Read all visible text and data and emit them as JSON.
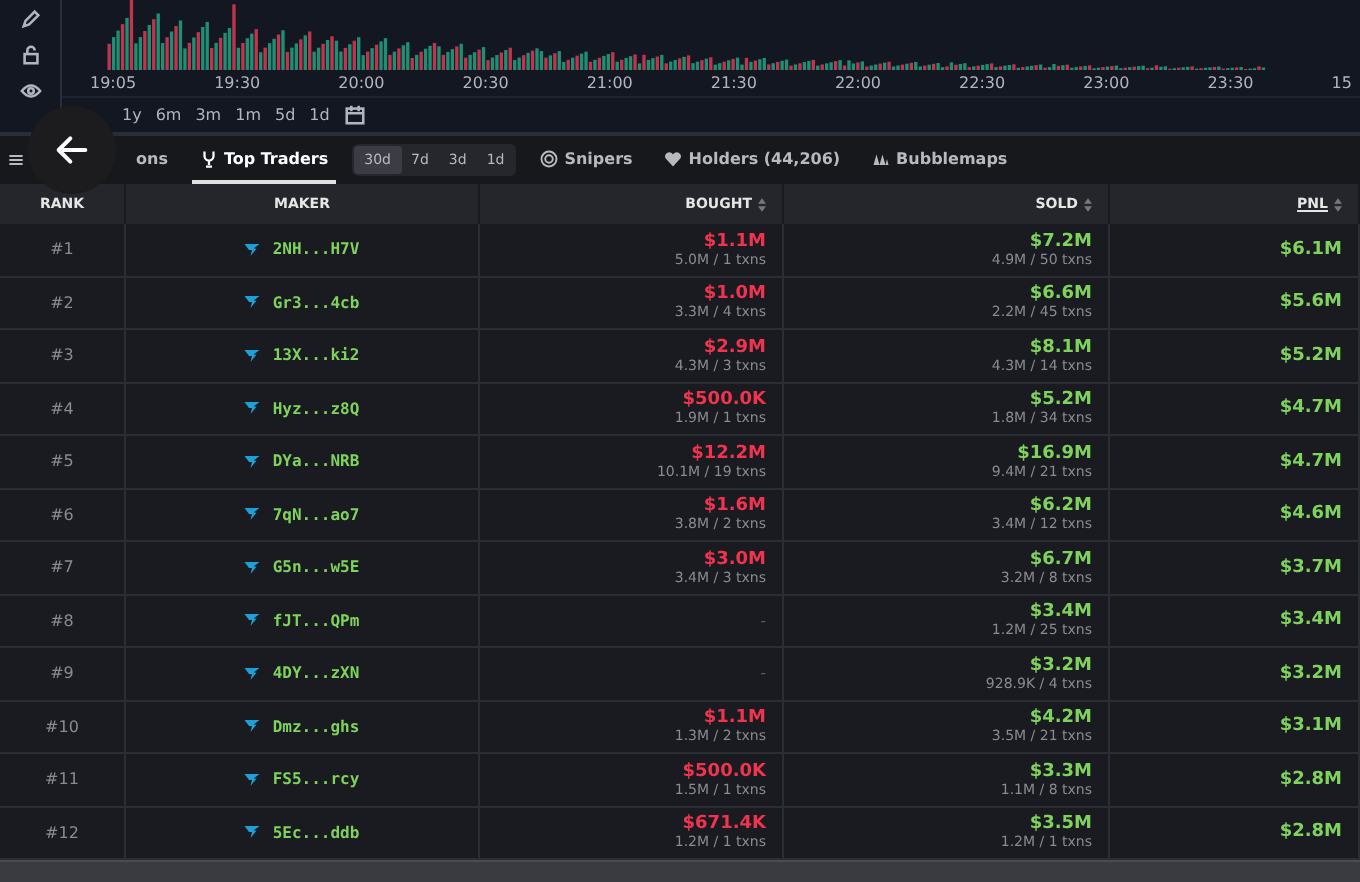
{
  "chart": {
    "time_labels": [
      "19:05",
      "19:30",
      "20:00",
      "20:30",
      "21:00",
      "21:30",
      "22:00",
      "22:30",
      "23:00",
      "23:30",
      "15"
    ]
  },
  "ranges": [
    {
      "label": "1y"
    },
    {
      "label": "6m"
    },
    {
      "label": "3m"
    },
    {
      "label": "1m"
    },
    {
      "label": "5d"
    },
    {
      "label": "1d"
    }
  ],
  "tabs": [
    {
      "label": "ons",
      "selected": false,
      "kind": "plain"
    },
    {
      "label": "Top Traders",
      "selected": true,
      "kind": "traders"
    },
    {
      "label": "Snipers",
      "selected": false,
      "kind": "snipers"
    },
    {
      "label": "Holders (44,206)",
      "selected": false,
      "kind": "holders"
    },
    {
      "label": "Bubblemaps",
      "selected": false,
      "kind": "bubbles"
    }
  ],
  "periods": [
    {
      "label": "30d",
      "selected": true
    },
    {
      "label": "7d",
      "selected": false
    },
    {
      "label": "3d",
      "selected": false
    },
    {
      "label": "1d",
      "selected": false
    }
  ],
  "table": {
    "columns": [
      "RANK",
      "MAKER",
      "BOUGHT",
      "SOLD",
      "PNL"
    ],
    "rows": [
      {
        "rank": "#1",
        "maker": "2NH...H7V",
        "bought": "$1.1M",
        "bought_detail": "5.0M / 1 txns",
        "sold": "$7.2M",
        "sold_detail": "4.9M / 50 txns",
        "pnl": "$6.1M"
      },
      {
        "rank": "#2",
        "maker": "Gr3...4cb",
        "bought": "$1.0M",
        "bought_detail": "3.3M / 4 txns",
        "sold": "$6.6M",
        "sold_detail": "2.2M / 45 txns",
        "pnl": "$5.6M"
      },
      {
        "rank": "#3",
        "maker": "13X...ki2",
        "bought": "$2.9M",
        "bought_detail": "4.3M / 3 txns",
        "sold": "$8.1M",
        "sold_detail": "4.3M / 14 txns",
        "pnl": "$5.2M"
      },
      {
        "rank": "#4",
        "maker": "Hyz...z8Q",
        "bought": "$500.0K",
        "bought_detail": "1.9M / 1 txns",
        "sold": "$5.2M",
        "sold_detail": "1.8M / 34 txns",
        "pnl": "$4.7M"
      },
      {
        "rank": "#5",
        "maker": "DYa...NRB",
        "bought": "$12.2M",
        "bought_detail": "10.1M / 19 txns",
        "sold": "$16.9M",
        "sold_detail": "9.4M / 21 txns",
        "pnl": "$4.7M"
      },
      {
        "rank": "#6",
        "maker": "7qN...ao7",
        "bought": "$1.6M",
        "bought_detail": "3.8M / 2 txns",
        "sold": "$6.2M",
        "sold_detail": "3.4M / 12 txns",
        "pnl": "$4.6M"
      },
      {
        "rank": "#7",
        "maker": "G5n...w5E",
        "bought": "$3.0M",
        "bought_detail": "3.4M / 3 txns",
        "sold": "$6.7M",
        "sold_detail": "3.2M / 8 txns",
        "pnl": "$3.7M"
      },
      {
        "rank": "#8",
        "maker": "fJT...QPm",
        "bought": "-",
        "sold": "$3.4M",
        "sold_detail": "1.2M / 25 txns",
        "pnl": "$3.4M"
      },
      {
        "rank": "#9",
        "maker": "4DY...zXN",
        "bought": "-",
        "sold": "$3.2M",
        "sold_detail": "928.9K / 4 txns",
        "pnl": "$3.2M"
      },
      {
        "rank": "#10",
        "maker": "Dmz...ghs",
        "bought": "$1.1M",
        "bought_detail": "1.3M / 2 txns",
        "sold": "$4.2M",
        "sold_detail": "3.5M / 21 txns",
        "pnl": "$3.1M"
      },
      {
        "rank": "#11",
        "maker": "FS5...rcy",
        "bought": "$500.0K",
        "bought_detail": "1.5M / 1 txns",
        "sold": "$3.3M",
        "sold_detail": "1.1M / 8 txns",
        "pnl": "$2.8M"
      },
      {
        "rank": "#12",
        "maker": "5Ec...ddb",
        "bought": "$671.4K",
        "bought_detail": "1.2M / 1 txns",
        "sold": "$3.5M",
        "sold_detail": "1.2M / 1 txns",
        "pnl": "$2.8M"
      }
    ]
  }
}
